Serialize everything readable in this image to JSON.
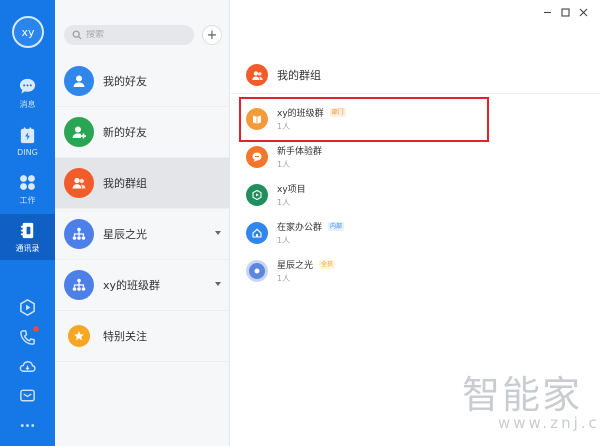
{
  "user": {
    "initials": "xy"
  },
  "rail": {
    "items": [
      {
        "label": "消息",
        "icon": "chat-icon"
      },
      {
        "label": "DING",
        "icon": "ding-icon"
      },
      {
        "label": "工作",
        "icon": "work-grid-icon"
      },
      {
        "label": "通讯录",
        "icon": "contacts-book-icon"
      }
    ],
    "bottom_icons": [
      "video-play-icon",
      "phone-icon",
      "cloud-icon",
      "mail-icon",
      "more-icon"
    ]
  },
  "search": {
    "placeholder": "搜索"
  },
  "add_button": {
    "label": "+"
  },
  "contacts": [
    {
      "name": "我的好友",
      "color": "#2f86eb",
      "icon": "person-icon"
    },
    {
      "name": "新的好友",
      "color": "#2aa553",
      "icon": "add-person-icon"
    },
    {
      "name": "我的群组",
      "color": "#f25b2a",
      "icon": "group-icon"
    },
    {
      "name": "星辰之光",
      "color": "#4d7fe8",
      "icon": "org-tree-icon"
    },
    {
      "name": "xy的班级群",
      "color": "#4d7fe8",
      "icon": "org-tree-icon"
    },
    {
      "name": "特别关注",
      "color": "#f6a623",
      "icon": "star-icon"
    }
  ],
  "pane": {
    "title": "我的群组"
  },
  "groups": [
    {
      "name": "xy的班级群",
      "count": "1人",
      "badge": "部门",
      "badge_style": "orange",
      "color": "#f39a3a",
      "icon": "class-book-icon"
    },
    {
      "name": "新手体验群",
      "count": "1人",
      "badge": "",
      "badge_style": "",
      "color": "#f2762b",
      "icon": "chat-bubble-icon"
    },
    {
      "name": "xy项目",
      "count": "1人",
      "badge": "",
      "badge_style": "",
      "color": "#1f8f5e",
      "icon": "project-cube-icon"
    },
    {
      "name": "在家办公群",
      "count": "1人",
      "badge": "内部",
      "badge_style": "blue",
      "color": "#2f86eb",
      "icon": "home-office-icon"
    },
    {
      "name": "星辰之光",
      "count": "1人",
      "badge": "全员",
      "badge_style": "amber",
      "color": "#5d86e0",
      "icon": "light-ring-icon"
    }
  ],
  "watermark": {
    "main": "智能家",
    "sub": "www.znj.com"
  }
}
